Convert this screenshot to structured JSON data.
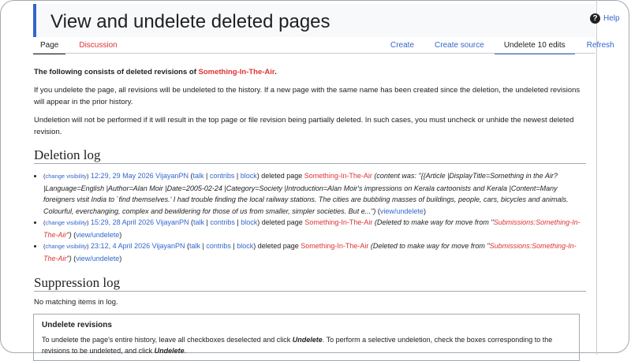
{
  "title": "View and undelete deleted pages",
  "help": "Help",
  "tabs_left": [
    "Page",
    "Discussion"
  ],
  "tabs_right": [
    "Create",
    "Create source",
    "Undelete 10 edits",
    "Refresh"
  ],
  "intro": {
    "bold_prefix": "The following consists of deleted revisions of ",
    "page_link": "Something-In-The-Air",
    "bold_suffix": ".",
    "p1": "If you undelete the page, all revisions will be undeleted to the history. If a new page with the same name has been created since the deletion, the undeleted revisions will appear in the prior history.",
    "p2": "Undeletion will not be performed if it will result in the top page or file revision being partially deleted. In such cases, you must uncheck or unhide the newest deleted revision."
  },
  "deletion_log": {
    "heading": "Deletion log",
    "entries": [
      {
        "change_visibility": "change visibility",
        "timestamp": "12:29, 29 May 2026",
        "user": "VijayanPN",
        "talk": "talk",
        "contribs": "contribs",
        "block": "block",
        "action": "deleted page",
        "page": "Something-In-The-Air",
        "reason": "(content was: \"{{Article |DisplayTitle=Something in the Air? |Language=English |Author=Alan Moir |Date=2005-02-24 |Category=Society |Introduction=Alan Moir's impressions on Kerala cartoonists and Kerala |Content=Many foreigners visit India to `find themselves.' I had trouble finding the local railway stations. The cities are bubbling masses of buildings, people, cars, bicycles and animals. Colourful, everchanging, complex and bewildering for those of us from smaller, simpler societies. But e...\")",
        "view": "view/undelete"
      },
      {
        "change_visibility": "change visibility",
        "timestamp": "15:29, 28 April 2026",
        "user": "VijayanPN",
        "talk": "talk",
        "contribs": "contribs",
        "block": "block",
        "action": "deleted page",
        "page": "Something-In-The-Air",
        "reason_prefix": "(Deleted to make way for move from \"",
        "reason_link": "Submissions:Something-In-The-Air",
        "reason_suffix": "\")",
        "view": "view/undelete"
      },
      {
        "change_visibility": "change visibility",
        "timestamp": "23:12, 4 April 2026",
        "user": "VijayanPN",
        "talk": "talk",
        "contribs": "contribs",
        "block": "block",
        "action": "deleted page",
        "page": "Something-In-The-Air",
        "reason_prefix": "(Deleted to make way for move from \"",
        "reason_link": "Submissions:Something-In-The-Air",
        "reason_suffix": "\")",
        "view": "view/undelete"
      }
    ]
  },
  "suppression_log": {
    "heading": "Suppression log",
    "empty": "No matching items in log."
  },
  "undelete": {
    "heading": "Undelete revisions",
    "text_a": "To undelete the page's entire history, leave all checkboxes deselected and click ",
    "undelete_word": "Undelete",
    "text_b": ". To perform a selective undeletion, check the boxes corresponding to the revisions to be undeleted, and click ",
    "text_c": "."
  }
}
